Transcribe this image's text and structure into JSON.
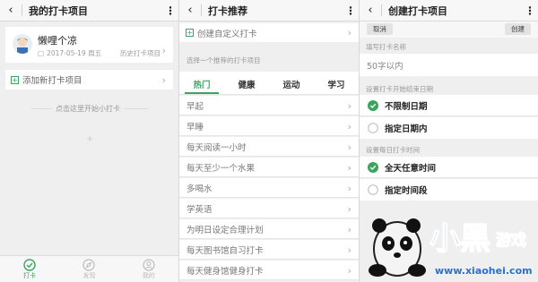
{
  "colors": {
    "accent": "#3aa55f",
    "background": "#efefef",
    "card": "#ffffff",
    "divider": "#d8d8d8"
  },
  "panel1": {
    "title": "我的打卡项目",
    "user_name": "懒哩个凉",
    "date": "2017-05-19 周五",
    "history_link": "历史打卡项目",
    "add_item": "添加新打卡项目",
    "hint": "点击这里开始小打卡",
    "nav": [
      {
        "label": "打卡",
        "icon": "check-circle-icon",
        "active": true
      },
      {
        "label": "发现",
        "icon": "compass-icon",
        "active": false
      },
      {
        "label": "我的",
        "icon": "user-icon",
        "active": false
      }
    ]
  },
  "panel2": {
    "title": "打卡推荐",
    "create_custom": "创建自定义打卡",
    "choose_hint": "选择一个推荐的打卡项目",
    "tabs": [
      "热门",
      "健康",
      "运动",
      "学习"
    ],
    "items": [
      "早起",
      "早睡",
      "每天阅读一小时",
      "每天至少一个水果",
      "多喝水",
      "学英语",
      "为明日设定合理计划",
      "每天图书馆自习打卡",
      "每天健身馆健身打卡"
    ]
  },
  "panel3": {
    "title": "创建打卡项目",
    "cancel": "取消",
    "create": "创建",
    "name_label": "填写打卡名称",
    "name_placeholder": "50字以内",
    "date_label": "设置打卡开始结束日期",
    "date_options": [
      "不限制日期",
      "指定日期内"
    ],
    "time_label": "设置每日打卡时间",
    "time_options": [
      "全天任意时间",
      "指定时间段"
    ]
  }
}
